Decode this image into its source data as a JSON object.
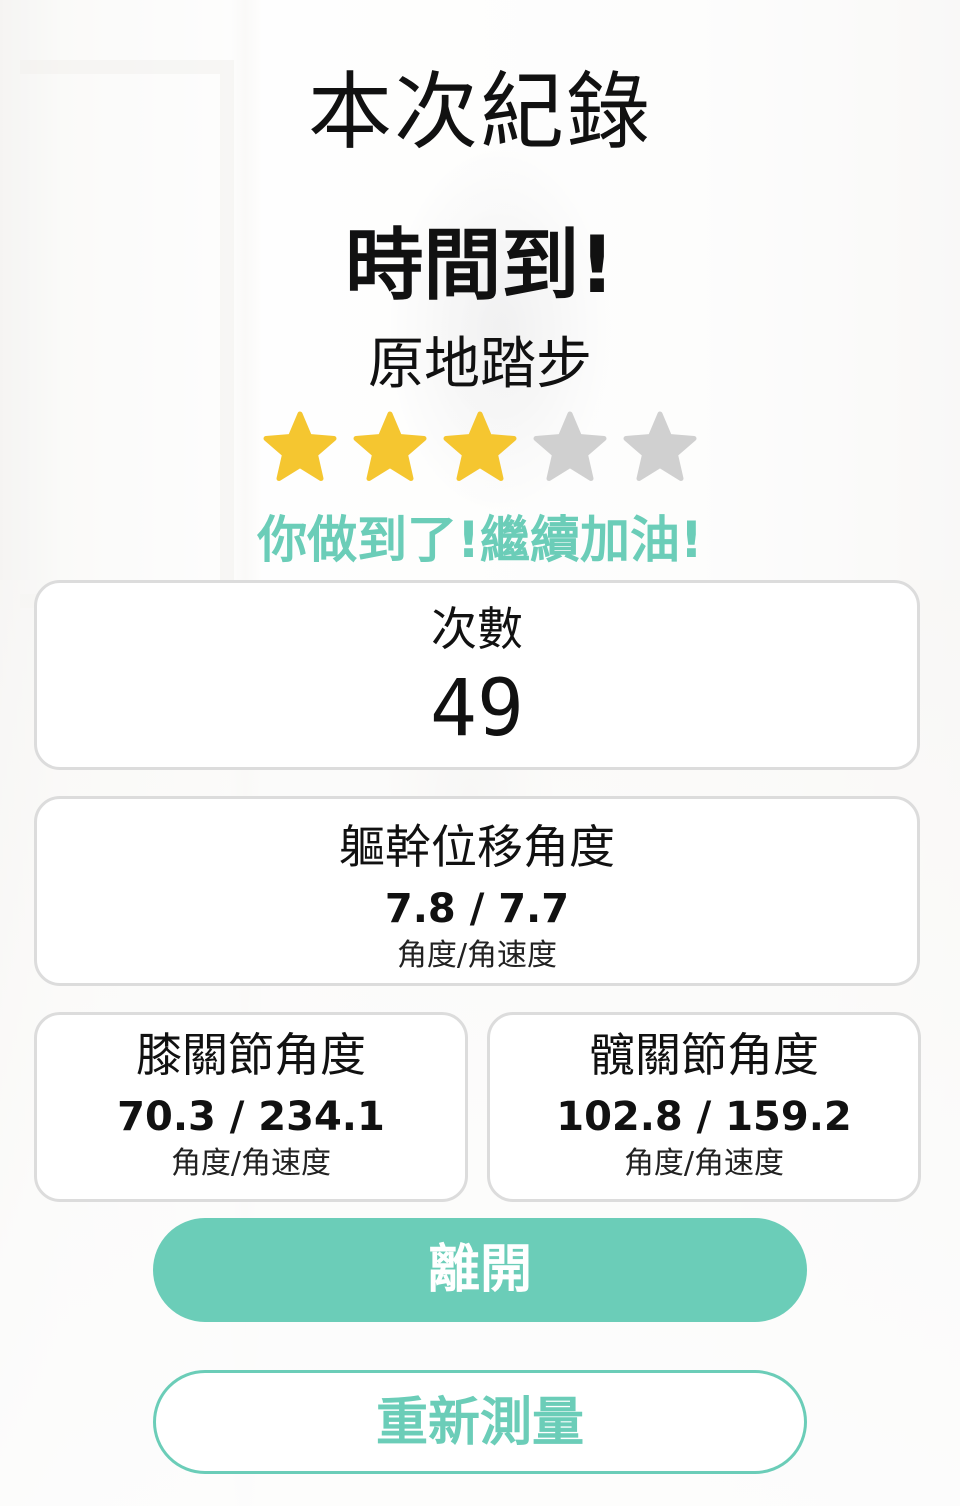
{
  "colors": {
    "accent": "#6bcdb8",
    "star_on": "#f5c630",
    "star_off": "#d0d0d0"
  },
  "header": {
    "title": "本次紀錄",
    "status": "時間到!",
    "exercise_name": "原地踏步"
  },
  "rating": {
    "value": 3,
    "max": 5
  },
  "encouragement": "你做到了!繼續加油!",
  "count_card": {
    "label": "次數",
    "value": "49"
  },
  "trunk_card": {
    "label": "軀幹位移角度",
    "value": "7.8 / 7.7",
    "unit": "角度/角速度"
  },
  "knee_card": {
    "label": "膝關節角度",
    "value": "70.3 / 234.1",
    "unit": "角度/角速度"
  },
  "hip_card": {
    "label": "髖關節角度",
    "value": "102.8 / 159.2",
    "unit": "角度/角速度"
  },
  "buttons": {
    "leave_label": "離開",
    "retry_label": "重新測量"
  }
}
